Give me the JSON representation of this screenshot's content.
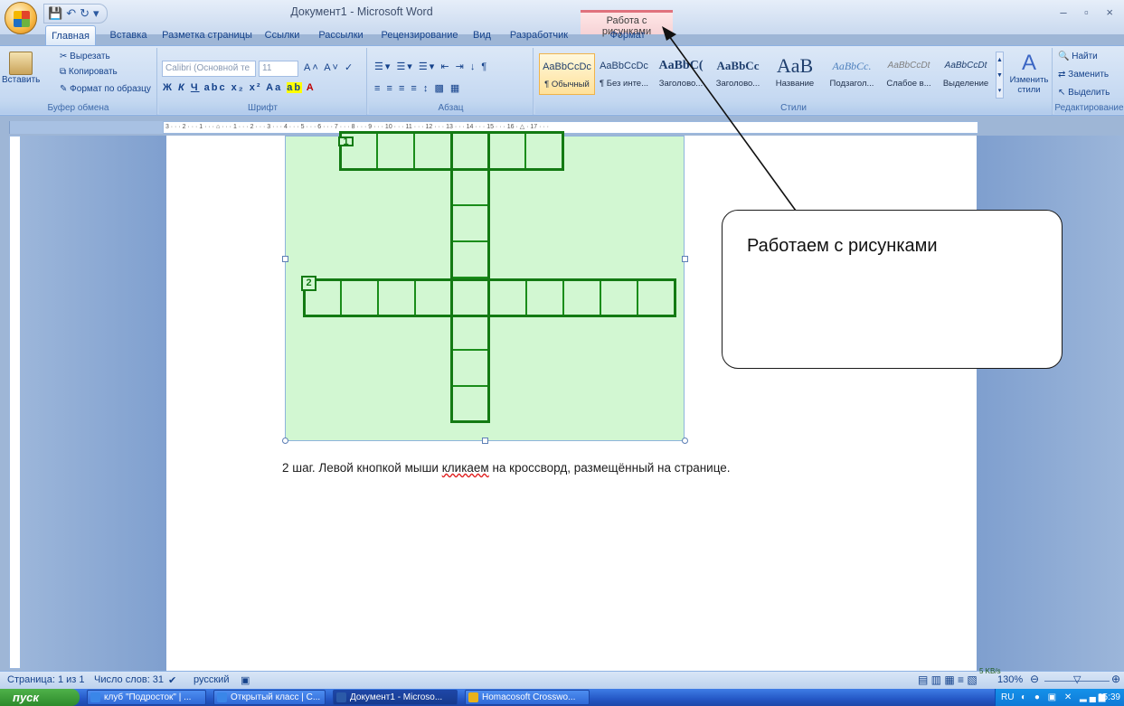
{
  "window": {
    "title": "Документ1 - Microsoft Word",
    "context_tab_group": "Работа с рисунками",
    "controls": "– ▫ ×"
  },
  "tabs": [
    "Главная",
    "Вставка",
    "Разметка страницы",
    "Ссылки",
    "Рассылки",
    "Рецензирование",
    "Вид",
    "Разработчик",
    "Формат"
  ],
  "ribbon": {
    "clipboard": {
      "paste": "Вставить",
      "cut": "Вырезать",
      "copy": "Копировать",
      "format_painter": "Формат по образцу",
      "label": "Буфер обмена"
    },
    "font": {
      "name": "Calibri (Основной те",
      "size": "11",
      "bold": "Ж",
      "italic": "К",
      "underline": "Ч",
      "label": "Шрифт"
    },
    "paragraph": {
      "label": "Абзац"
    },
    "styles": {
      "label": "Стили",
      "items": [
        {
          "sample": "AaBbCcDc",
          "name": "¶ Обычный"
        },
        {
          "sample": "AaBbCcDc",
          "name": "¶ Без инте..."
        },
        {
          "sample": "AaBbC(",
          "name": "Заголово..."
        },
        {
          "sample": "AaBbCc",
          "name": "Заголово..."
        },
        {
          "sample": "AaB",
          "name": "Название"
        },
        {
          "sample": "AaBbCc.",
          "name": "Подзагол..."
        },
        {
          "sample": "AaBbCcDt",
          "name": "Слабое в..."
        },
        {
          "sample": "AaBbCcDt",
          "name": "Выделение"
        }
      ],
      "change_styles": "Изменить стили"
    },
    "editing": {
      "label": "Редактирование",
      "find": "Найти",
      "replace": "Заменить",
      "select": "Выделить"
    }
  },
  "document": {
    "crossword_numbers": [
      "1",
      "2"
    ],
    "step_text_before": "2 шаг. Левой кнопкой мыши ",
    "step_text_error_word": "кликаем",
    "step_text_after": " на кроссворд, размещённый на странице."
  },
  "callout": {
    "text": "Работаем с рисунками"
  },
  "statusbar": {
    "page": "Страница: 1 из 1",
    "words": "Число слов: 31",
    "language": "русский",
    "net_speed": "5 KB/s",
    "zoom": "130%"
  },
  "taskbar": {
    "start": "пуск",
    "tasks": [
      {
        "label": "клуб \"Подросток\" | ...",
        "icon_color": "#3a86e8"
      },
      {
        "label": "Открытый класс | С...",
        "icon_color": "#3a86e8"
      },
      {
        "label": "Документ1 - Microso...",
        "icon_color": "#2b5aa8",
        "active": true
      },
      {
        "label": "Homacosoft Crosswo...",
        "icon_color": "#e9b21a"
      }
    ],
    "tray_lang": "RU",
    "clock": "15:39"
  }
}
